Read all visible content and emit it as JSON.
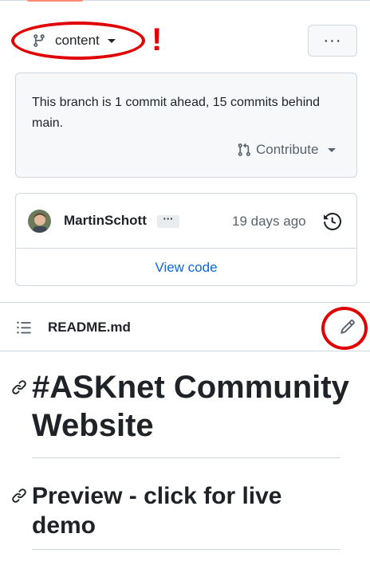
{
  "branch": {
    "name": "content",
    "icon": "git-branch-icon"
  },
  "annotation": {
    "mark": "!"
  },
  "more_button": {
    "label": "···"
  },
  "ahead_notice": {
    "text": "This branch is 1 commit ahead, 15 commits behind main.",
    "contribute_label": "Contribute"
  },
  "commit": {
    "author": "MartinSchott",
    "ellipsis": "···",
    "date": "19 days ago",
    "view_code": "View code"
  },
  "readme": {
    "title": "README.md",
    "heading1": "#ASKnet Community Website",
    "heading2": "Preview - click for live demo"
  },
  "colors": {
    "link": "#0969da",
    "annotation_red": "#e00000",
    "border": "#d0d7de",
    "accent": "#fd8c73"
  }
}
